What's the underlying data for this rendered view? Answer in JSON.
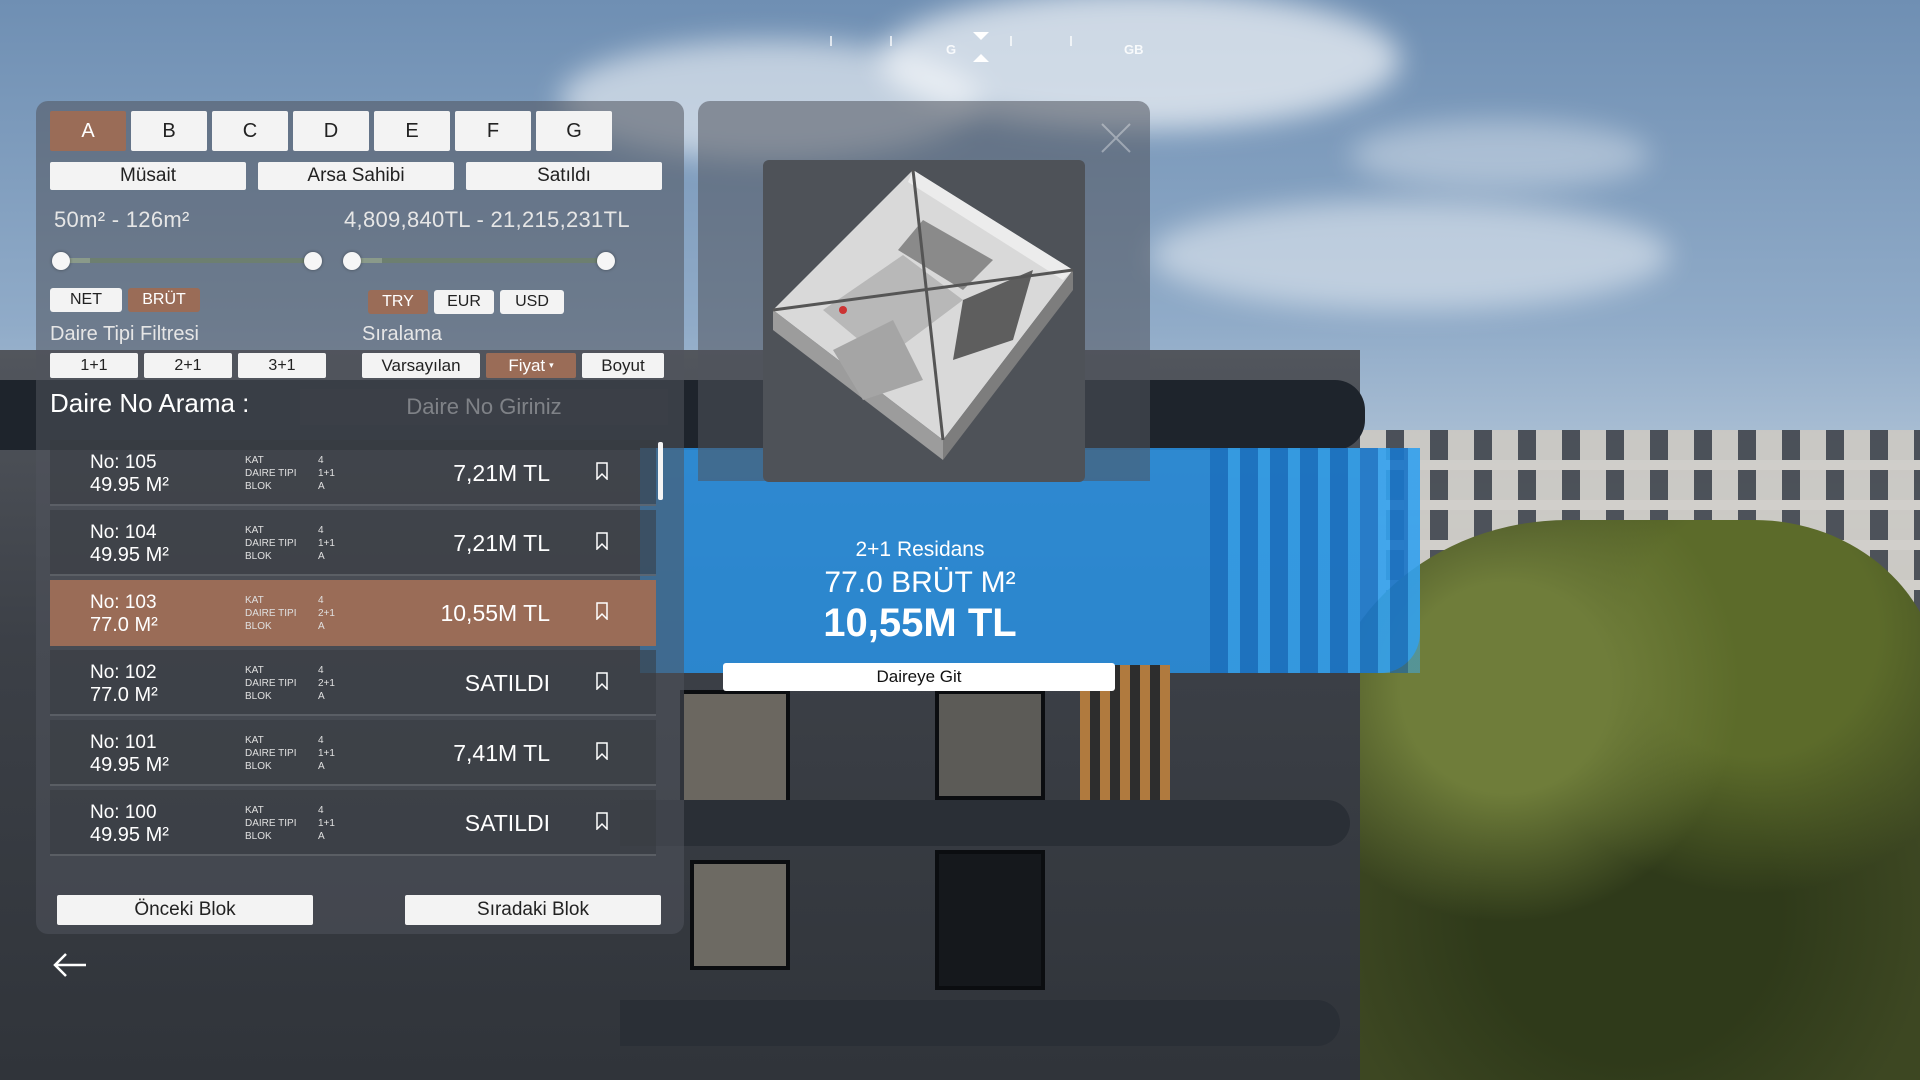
{
  "compass": {
    "left_mark": "G",
    "right_mark": "GB"
  },
  "blocks": [
    "A",
    "B",
    "C",
    "D",
    "E",
    "F",
    "G"
  ],
  "active_block": "A",
  "status_filters": [
    "Müsait",
    "Arsa Sahibi",
    "Satıldı"
  ],
  "area_range": {
    "text": "50m² - 126m²",
    "min": 50,
    "max": 126
  },
  "price_range": {
    "text": "4,809,840TL - 21,215,231TL",
    "min": 4809840,
    "max": 21215231
  },
  "area_modes": [
    "NET",
    "BRÜT"
  ],
  "active_area_mode": "BRÜT",
  "currencies": [
    "TRY",
    "EUR",
    "USD"
  ],
  "active_currency": "TRY",
  "type_filter_label": "Daire Tipi Filtresi",
  "type_filters": [
    "1+1",
    "2+1",
    "3+1"
  ],
  "sort_label": "Sıralama",
  "sort_options": [
    "Varsayılan",
    "Fiyat",
    "Boyut"
  ],
  "active_sort": "Fiyat",
  "search": {
    "label": "Daire No Arama :",
    "placeholder": "Daire No Giriniz"
  },
  "meta_labels": [
    "KAT",
    "DAIRE TIPI",
    "BLOK"
  ],
  "units": [
    {
      "no": "No: 105",
      "area": "49.95 M²",
      "floor": "4",
      "type": "1+1",
      "block": "A",
      "price": "7,21M TL",
      "selected": false
    },
    {
      "no": "No: 104",
      "area": "49.95 M²",
      "floor": "4",
      "type": "1+1",
      "block": "A",
      "price": "7,21M TL",
      "selected": false
    },
    {
      "no": "No: 103",
      "area": "77.0 M²",
      "floor": "4",
      "type": "2+1",
      "block": "A",
      "price": "10,55M TL",
      "selected": true
    },
    {
      "no": "No: 102",
      "area": "77.0 M²",
      "floor": "4",
      "type": "2+1",
      "block": "A",
      "price": "SATILDI",
      "selected": false
    },
    {
      "no": "No: 101",
      "area": "49.95 M²",
      "floor": "4",
      "type": "1+1",
      "block": "A",
      "price": "7,41M TL",
      "selected": false
    },
    {
      "no": "No: 100",
      "area": "49.95 M²",
      "floor": "4",
      "type": "1+1",
      "block": "A",
      "price": "SATILDI",
      "selected": false
    }
  ],
  "nav": {
    "prev": "Önceki Blok",
    "next": "Sıradaki Blok"
  },
  "detail": {
    "type": "2+1 Residans",
    "area": "77.0 BRÜT M²",
    "price": "10,55M TL",
    "goto_label": "Daireye Git"
  },
  "colors": {
    "accent": "#9a6c57",
    "highlight_blue": "#2896eb"
  }
}
